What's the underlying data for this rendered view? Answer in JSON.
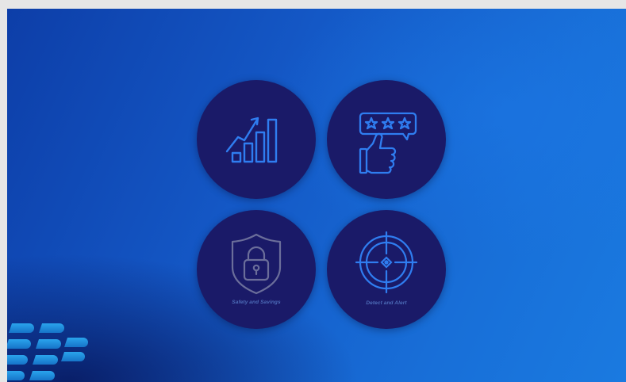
{
  "features": [
    {
      "icon": "growth-chart-icon",
      "caption": ""
    },
    {
      "icon": "thumbs-up-rating-icon",
      "caption": ""
    },
    {
      "icon": "shield-lock-icon",
      "caption": "Safety and Savings"
    },
    {
      "icon": "crosshair-target-icon",
      "caption": "Detect and Alert"
    }
  ],
  "colors": {
    "background_dark": "#0d3ea8",
    "background_light": "#1a7ae0",
    "tile": "#1a1a68",
    "icon_blue": "#2f7df0",
    "icon_grey": "#6b6e9a",
    "logo": "#1e88d8"
  },
  "brand": {
    "logo_icon": "blackberry-logo-icon"
  }
}
